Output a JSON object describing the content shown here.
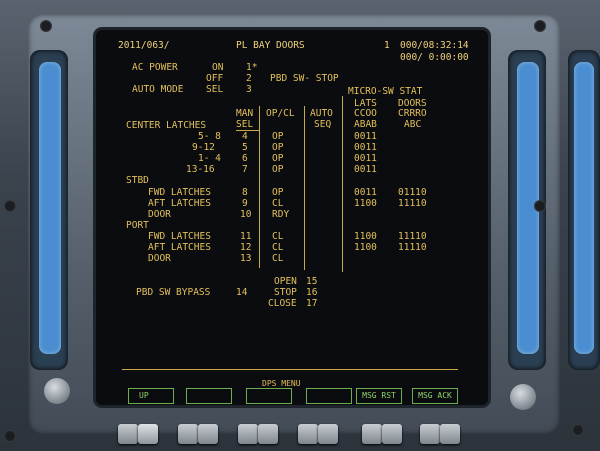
{
  "header": {
    "date": "2011/063/",
    "title": "PL BAY DOORS",
    "crt_num": "1",
    "met": "000/08:32:14",
    "cdt": "000/ 0:00:00"
  },
  "ac_power": {
    "label": "AC POWER",
    "on_label": "ON",
    "on_item": "1*",
    "off_label": "OFF",
    "off_item": "2"
  },
  "auto_mode": {
    "label": "AUTO MODE",
    "sel_label": "SEL",
    "item": "3"
  },
  "pbd_sw_status": "PBD SW- STOP",
  "column_headers": {
    "micro_sw_stat": "MICRO-SW STAT",
    "man": "MAN",
    "sel": "SEL",
    "op_cl": "OP/CL",
    "auto": "AUTO",
    "seq": "SEQ",
    "lats": "LATS",
    "lats_codes1": "CCOO",
    "lats_codes2": "ABAB",
    "doors": "DOORS",
    "doors_codes1": "CRRRO",
    "doors_codes2": "ABC"
  },
  "center_latches": {
    "label": "CENTER LATCHES",
    "rows": [
      {
        "name": "5- 8",
        "item": "4",
        "opcl": "OP",
        "lats": "0011"
      },
      {
        "name": "9-12",
        "item": "5",
        "opcl": "OP",
        "lats": "0011"
      },
      {
        "name": "1- 4",
        "item": "6",
        "opcl": "OP",
        "lats": "0011"
      },
      {
        "name": "13-16",
        "item": "7",
        "opcl": "OP",
        "lats": "0011"
      }
    ]
  },
  "stbd": {
    "label": "STBD",
    "rows": [
      {
        "name": "FWD LATCHES",
        "item": "8",
        "opcl": "OP",
        "lats": "0011",
        "doors": "01110"
      },
      {
        "name": "AFT LATCHES",
        "item": "9",
        "opcl": "CL",
        "lats": "1100",
        "doors": "11110"
      },
      {
        "name": "DOOR",
        "item": "10",
        "opcl": "RDY"
      }
    ]
  },
  "port": {
    "label": "PORT",
    "rows": [
      {
        "name": "FWD LATCHES",
        "item": "11",
        "opcl": "CL",
        "lats": "1100",
        "doors": "11110"
      },
      {
        "name": "AFT LATCHES",
        "item": "12",
        "opcl": "CL",
        "lats": "1100",
        "doors": "11110"
      },
      {
        "name": "DOOR",
        "item": "13",
        "opcl": "CL"
      }
    ]
  },
  "seq_cmds": [
    {
      "label": "OPEN",
      "item": "15"
    },
    {
      "label": "STOP",
      "item": "16"
    },
    {
      "label": "CLOSE",
      "item": "17"
    }
  ],
  "bypass": {
    "label": "PBD SW BYPASS",
    "item": "14"
  },
  "function_keys": {
    "up": "UP",
    "dps_menu": "DPS MENU",
    "msg_rst": "MSG RST",
    "msg_ack": "MSG ACK"
  },
  "colors": {
    "text": "#e2c05a",
    "keys": "#8fd36a",
    "screen": "#0b0c10"
  }
}
